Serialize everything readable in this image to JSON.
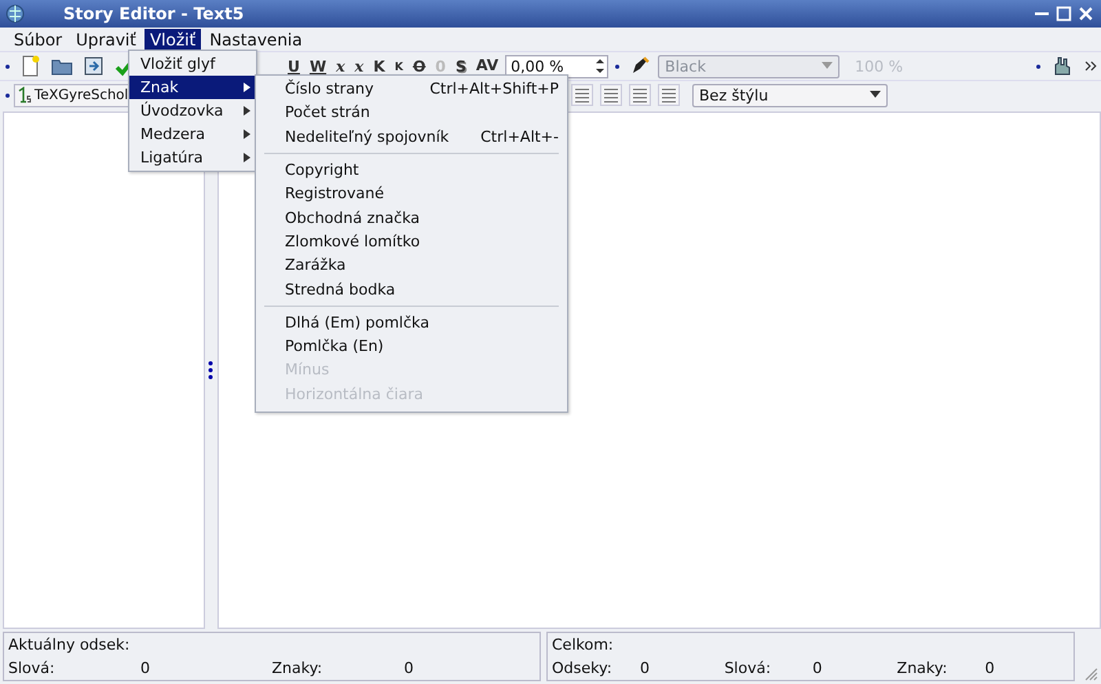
{
  "window": {
    "title": "Story Editor - Text5"
  },
  "menubar": [
    {
      "label": "Súbor",
      "selected": false
    },
    {
      "label": "Upraviť",
      "selected": false
    },
    {
      "label": "Vložiť",
      "selected": true
    },
    {
      "label": "Nastavenia",
      "selected": false
    }
  ],
  "toolbar": {
    "style_glyphs": [
      {
        "glyph": "U",
        "kind": "underline"
      },
      {
        "glyph": "W",
        "kind": "underline"
      },
      {
        "glyph": "x",
        "kind": "sub"
      },
      {
        "glyph": "x",
        "kind": "sup"
      },
      {
        "glyph": "K",
        "kind": "plain"
      },
      {
        "glyph": "K",
        "kind": "small"
      },
      {
        "glyph": "O",
        "kind": "strike"
      },
      {
        "glyph": "0",
        "kind": "outline"
      },
      {
        "glyph": "S",
        "kind": "shadow"
      },
      {
        "glyph": "AV",
        "kind": "kern"
      }
    ],
    "tracking": "0,00 %",
    "color": {
      "value": "Black",
      "disabled": true
    },
    "shade": "100 %",
    "font": "TeXGyreSchol",
    "style": "Bez štýlu"
  },
  "insert_menu": [
    {
      "label": "Vložiť glyf",
      "submenu": false,
      "selected": false
    },
    {
      "label": "Znak",
      "submenu": true,
      "selected": true
    },
    {
      "label": "Úvodzovka",
      "submenu": true,
      "selected": false
    },
    {
      "label": "Medzera",
      "submenu": true,
      "selected": false
    },
    {
      "label": "Ligatúra",
      "submenu": true,
      "selected": false
    }
  ],
  "character_submenu": [
    {
      "kind": "item",
      "label": "Číslo strany",
      "shortcut": "Ctrl+Alt+Shift+P",
      "disabled": false
    },
    {
      "kind": "item",
      "label": "Počet strán",
      "disabled": false
    },
    {
      "kind": "item",
      "label": "Nedeliteľný spojovník",
      "shortcut": "Ctrl+Alt+-",
      "disabled": false
    },
    {
      "kind": "separator"
    },
    {
      "kind": "item",
      "label": "Copyright",
      "disabled": false
    },
    {
      "kind": "item",
      "label": "Registrované",
      "disabled": false
    },
    {
      "kind": "item",
      "label": "Obchodná značka",
      "disabled": false
    },
    {
      "kind": "item",
      "label": "Zlomkové lomítko",
      "disabled": false
    },
    {
      "kind": "item",
      "label": "Zarážka",
      "disabled": false
    },
    {
      "kind": "item",
      "label": "Stredná bodka",
      "disabled": false
    },
    {
      "kind": "separator"
    },
    {
      "kind": "item",
      "label": "Dlhá (Em) pomlčka",
      "disabled": false
    },
    {
      "kind": "item",
      "label": "Pomlčka (En)",
      "disabled": false
    },
    {
      "kind": "item",
      "label": "Mínus",
      "disabled": true
    },
    {
      "kind": "item",
      "label": "Horizontálna čiara",
      "disabled": true
    }
  ],
  "status": {
    "current": {
      "title": "Aktuálny odsek:",
      "fields": [
        {
          "label": "Slová:",
          "value": "0"
        },
        {
          "label": "Znaky:",
          "value": "0"
        }
      ]
    },
    "total": {
      "title": "Celkom:",
      "fields": [
        {
          "label": "Odseky:",
          "value": "0"
        },
        {
          "label": "Slová:",
          "value": "0"
        },
        {
          "label": "Znaky:",
          "value": "0"
        }
      ]
    }
  }
}
